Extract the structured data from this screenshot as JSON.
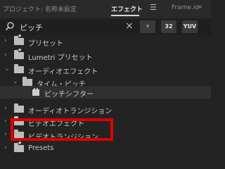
{
  "tabs": {
    "project": "プロジェクト: 名称未設定",
    "effects": "エフェクト",
    "effects_menu_icon": "hamburger-menu-icon",
    "frameio": "Frame.io",
    "panel_menu_icon": "chevron-double-right-icon"
  },
  "search": {
    "icon": "search-icon",
    "value": "ピッチ",
    "clear_icon": "close-icon"
  },
  "filters": {
    "accelerated": "⚡",
    "bit32": "32",
    "yuv": "YUV"
  },
  "tree": {
    "items": [
      {
        "label": "プリセット",
        "expanded": false,
        "icon": "preset-folder-icon"
      },
      {
        "label": "Lumetri プリセット",
        "expanded": false,
        "icon": "preset-folder-icon"
      },
      {
        "label": "オーディオエフェクト",
        "expanded": true,
        "icon": "folder-icon"
      },
      {
        "label": "タイム・ピッチ",
        "expanded": true,
        "icon": "folder-icon"
      },
      {
        "label": "ピッチシフター",
        "selected": true,
        "icon": "audio-effect-icon"
      },
      {
        "label": "オーディオトランジション",
        "expanded": false,
        "icon": "folder-icon"
      },
      {
        "label": "ビデオエフェクト",
        "expanded": false,
        "icon": "folder-icon"
      },
      {
        "label": "ビデオトランジション",
        "expanded": false,
        "icon": "folder-icon"
      },
      {
        "label": "Presets",
        "expanded": false,
        "icon": "preset-folder-icon"
      }
    ]
  },
  "colors": {
    "highlight": "#e00000",
    "panel_background": "#232323",
    "active_tab": "#f0f0f0"
  }
}
